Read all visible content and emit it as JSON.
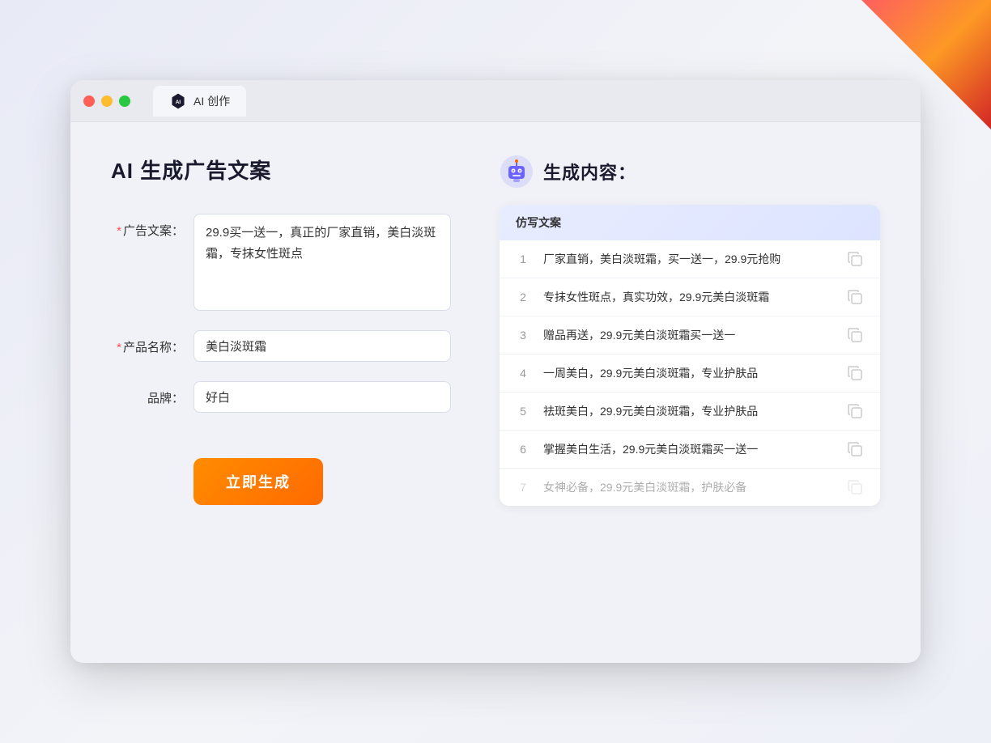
{
  "browser": {
    "tab_title": "AI 创作",
    "traffic_lights": [
      "red",
      "yellow",
      "green"
    ]
  },
  "left_panel": {
    "page_title": "AI 生成广告文案",
    "form": {
      "ad_copy_label": "广告文案：",
      "ad_copy_required": "*",
      "ad_copy_value": "29.9买一送一，真正的厂家直销，美白淡斑霜，专抹女性斑点",
      "product_name_label": "产品名称：",
      "product_name_required": "*",
      "product_name_value": "美白淡斑霜",
      "brand_label": "品牌：",
      "brand_value": "好白",
      "generate_button": "立即生成"
    }
  },
  "right_panel": {
    "title": "生成内容：",
    "results_header": "仿写文案",
    "results": [
      {
        "num": "1",
        "text": "厂家直销，美白淡斑霜，买一送一，29.9元抢购"
      },
      {
        "num": "2",
        "text": "专抹女性斑点，真实功效，29.9元美白淡斑霜"
      },
      {
        "num": "3",
        "text": "赠品再送，29.9元美白淡斑霜买一送一"
      },
      {
        "num": "4",
        "text": "一周美白，29.9元美白淡斑霜，专业护肤品"
      },
      {
        "num": "5",
        "text": "祛斑美白，29.9元美白淡斑霜，专业护肤品"
      },
      {
        "num": "6",
        "text": "掌握美白生活，29.9元美白淡斑霜买一送一"
      },
      {
        "num": "7",
        "text": "女神必备，29.9元美白淡斑霜，护肤必备",
        "dimmed": true
      }
    ]
  }
}
